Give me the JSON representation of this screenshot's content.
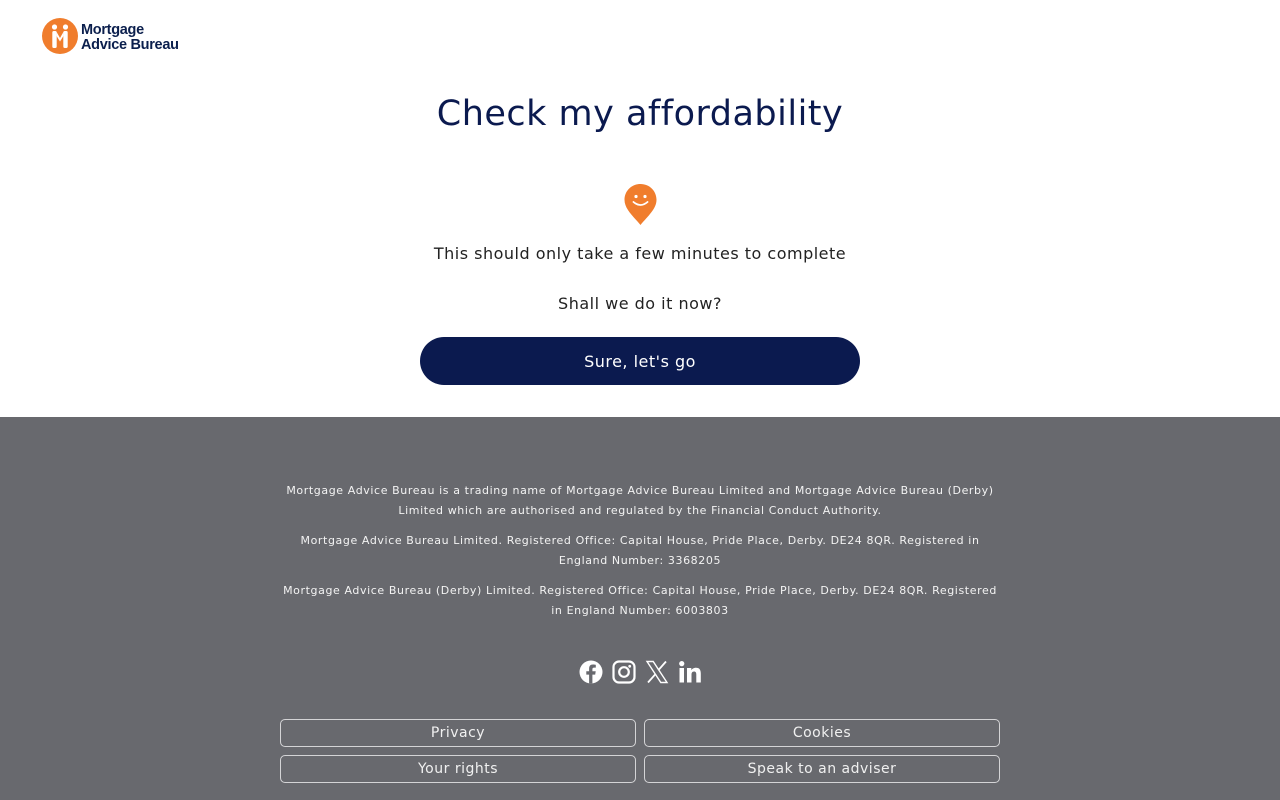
{
  "header": {
    "logo_line1": "Mortgage",
    "logo_line2": "Advice Bureau",
    "logo_icon": "mab-logo-icon",
    "brand_color": "#f07d2d"
  },
  "main": {
    "title": "Check my affordability",
    "icon": "smiley-pin-icon",
    "subtitle": "This should only take a few minutes to complete",
    "question": "Shall we do it now?",
    "cta_label": "Sure, let's go",
    "cta_color": "#0b1a4f"
  },
  "footer": {
    "background": "#68696e",
    "legal": [
      "Mortgage Advice Bureau is a trading name of Mortgage Advice Bureau Limited and Mortgage Advice Bureau (Derby) Limited which are authorised and regulated by the Financial Conduct Authority.",
      "Mortgage Advice Bureau Limited. Registered Office: Capital House, Pride Place, Derby. DE24 8QR. Registered in England Number: 3368205",
      "Mortgage Advice Bureau (Derby) Limited. Registered Office: Capital House, Pride Place, Derby. DE24 8QR. Registered in England Number: 6003803"
    ],
    "socials": [
      "facebook-icon",
      "instagram-icon",
      "x-icon",
      "linkedin-icon"
    ],
    "links": [
      "Privacy",
      "Cookies",
      "Your rights",
      "Speak to an adviser"
    ]
  }
}
